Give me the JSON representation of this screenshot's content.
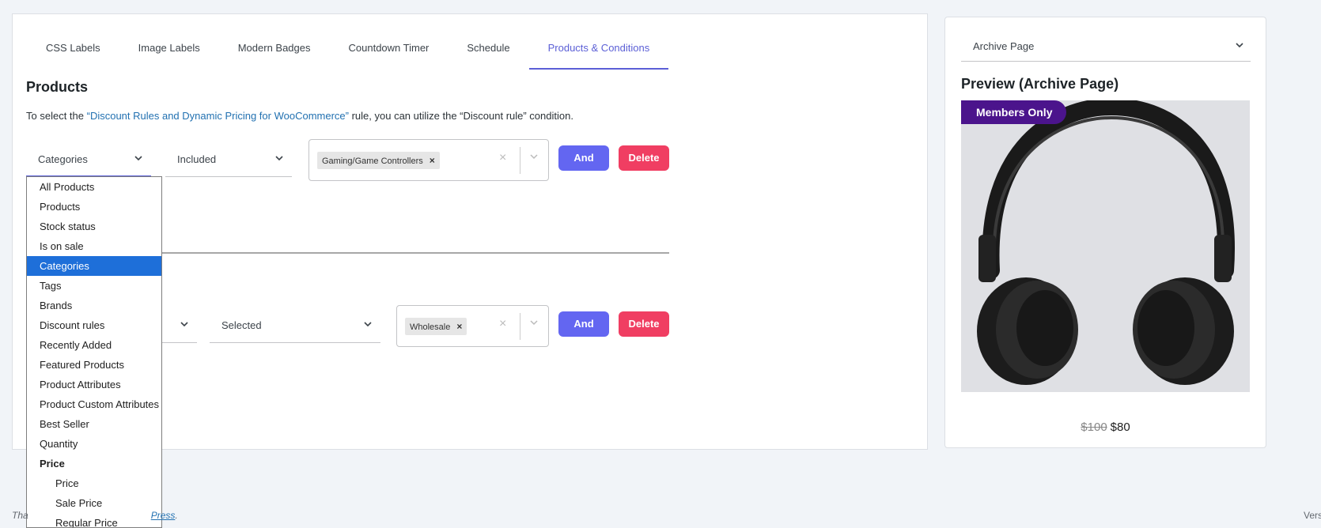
{
  "tabs": [
    "CSS Labels",
    "Image Labels",
    "Modern Badges",
    "Countdown Timer",
    "Schedule",
    "Products & Conditions"
  ],
  "section": {
    "title": "Products",
    "desc_pre": "To select the ",
    "desc_link": "“Discount Rules and Dynamic Pricing for WooCommerce”",
    "desc_post": " rule, you can utilize the “Discount rule” condition."
  },
  "row1": {
    "condition": "Categories",
    "operator": "Included",
    "chip": "Gaming/Game Controllers",
    "and_label": "And",
    "delete_label": "Delete"
  },
  "row2": {
    "operator": "Selected",
    "chip": "Wholesale",
    "and_label": "And",
    "delete_label": "Delete"
  },
  "dropdown": {
    "options": [
      "All Products",
      "Products",
      "Stock status",
      "Is on sale",
      "Categories",
      "Tags",
      "Brands",
      "Discount rules",
      "Recently Added",
      "Featured Products",
      "Product Attributes",
      "Product Custom Attributes",
      "Best Seller",
      "Quantity"
    ],
    "selected": "Categories",
    "group_label": "Price",
    "group_options": [
      "Price",
      "Sale Price",
      "Regular Price"
    ]
  },
  "preview": {
    "select_value": "Archive Page",
    "title": "Preview (Archive Page)",
    "badge": "Members Only",
    "old_price": "$100",
    "new_price": "$80"
  },
  "footer": {
    "left_partial": "Tha",
    "left_link": "Press",
    "left_end": ".",
    "right_partial": "Vers"
  },
  "colors": {
    "accent": "#5b5fd6",
    "and_button": "#6366f1",
    "delete_button": "#f03e62",
    "badge": "#4b148c",
    "selected_option": "#1e6fd9"
  }
}
